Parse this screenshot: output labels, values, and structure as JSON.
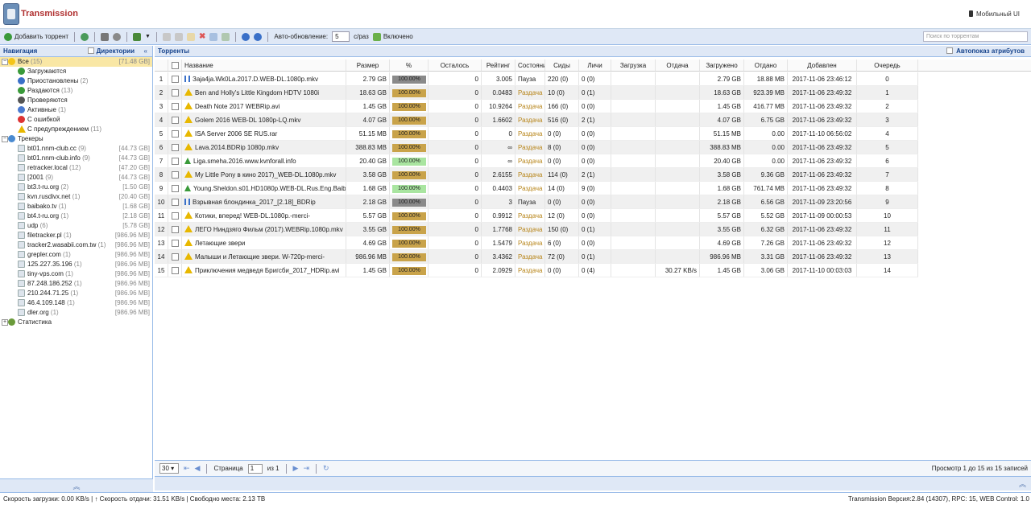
{
  "header": {
    "title": "Transmission",
    "mobile": "Мобильный UI"
  },
  "toolbar": {
    "add": "Добавить торрент",
    "auto_label": "Авто-обновление:",
    "auto_value": "5",
    "per": "с/раз",
    "enabled": "Включено",
    "search_placeholder": "Поиск по торрентам"
  },
  "nav": {
    "title": "Навигация",
    "dirs": "Директории",
    "items": [
      {
        "label": "Все",
        "count": "(15)",
        "size": "[71.48 GB]"
      },
      {
        "label": "Загружаются",
        "count": "",
        "size": ""
      },
      {
        "label": "Приостановлены",
        "count": "(2)",
        "size": ""
      },
      {
        "label": "Раздаются",
        "count": "(13)",
        "size": ""
      },
      {
        "label": "Проверяются",
        "count": "",
        "size": ""
      },
      {
        "label": "Активные",
        "count": "(1)",
        "size": ""
      },
      {
        "label": "С ошибкой",
        "count": "",
        "size": ""
      },
      {
        "label": "С предупреждением",
        "count": "(11)",
        "size": ""
      },
      {
        "label": "Трекеры",
        "count": "",
        "size": ""
      },
      {
        "label": "bt01.nnm-club.cc",
        "count": "(9)",
        "size": "[44.73 GB]"
      },
      {
        "label": "bt01.nnm-club.info",
        "count": "(9)",
        "size": "[44.73 GB]"
      },
      {
        "label": "retracker.local",
        "count": "(12)",
        "size": "[47.20 GB]"
      },
      {
        "label": "[2001",
        "count": "(9)",
        "size": "[44.73 GB]"
      },
      {
        "label": "bt3.t-ru.org",
        "count": "(2)",
        "size": "[1.50 GB]"
      },
      {
        "label": "kvn.rusdivx.net",
        "count": "(1)",
        "size": "[20.40 GB]"
      },
      {
        "label": "baibako.tv",
        "count": "(1)",
        "size": "[1.68 GB]"
      },
      {
        "label": "bt4.t-ru.org",
        "count": "(1)",
        "size": "[2.18 GB]"
      },
      {
        "label": "udp",
        "count": "(6)",
        "size": "[5.78 GB]"
      },
      {
        "label": "filetracker.pl",
        "count": "(1)",
        "size": "[986.96 MB]"
      },
      {
        "label": "tracker2.wasabii.com.tw",
        "count": "(1)",
        "size": "[986.96 MB]"
      },
      {
        "label": "grepler.com",
        "count": "(1)",
        "size": "[986.96 MB]"
      },
      {
        "label": "125.227.35.196",
        "count": "(1)",
        "size": "[986.96 MB]"
      },
      {
        "label": "tiny-vps.com",
        "count": "(1)",
        "size": "[986.96 MB]"
      },
      {
        "label": "87.248.186.252",
        "count": "(1)",
        "size": "[986.96 MB]"
      },
      {
        "label": "210.244.71.25",
        "count": "(1)",
        "size": "[986.96 MB]"
      },
      {
        "label": "46.4.109.148",
        "count": "(1)",
        "size": "[986.96 MB]"
      },
      {
        "label": "dler.org",
        "count": "(1)",
        "size": "[986.96 MB]"
      },
      {
        "label": "Статистика",
        "count": "",
        "size": ""
      }
    ]
  },
  "torrents": {
    "title": "Торренты",
    "autoshow": "Автопоказ атрибутов",
    "columns": [
      "Название",
      "Размер",
      "%",
      "Осталось",
      "Рейтинг",
      "Состояние",
      "Сиды",
      "Личи",
      "Загрузка",
      "Отдача",
      "Загружено",
      "Отдано",
      "Добавлен",
      "Очередь"
    ],
    "rows": [
      {
        "n": "1",
        "name": "Зajа4ja.Wk0La.2017.D.WEB-DL.1080p.mkv",
        "size": "2.79 GB",
        "pct": "100.00%",
        "left": "0",
        "ratio": "3.005",
        "state": "Пауза",
        "seeds": "220 (0)",
        "leech": "0 (0)",
        "down": "",
        "up": "",
        "dl": "2.79 GB",
        "ul": "18.88 MB",
        "added": "2017-11-06 23:46:12",
        "queue": "0",
        "icon": "pause",
        "bar": "gray"
      },
      {
        "n": "2",
        "name": "Ben and Holly's Little Kingdom HDTV 1080i",
        "size": "18.63 GB",
        "pct": "100.00%",
        "left": "0",
        "ratio": "0.0483",
        "state": "Раздача",
        "seeds": "10 (0)",
        "leech": "0 (1)",
        "down": "",
        "up": "",
        "dl": "18.63 GB",
        "ul": "923.39 MB",
        "added": "2017-11-06 23:49:32",
        "queue": "1",
        "icon": "warn",
        "bar": "gold"
      },
      {
        "n": "3",
        "name": "Death Note 2017 WEBRip.avi",
        "size": "1.45 GB",
        "pct": "100.00%",
        "left": "0",
        "ratio": "10.9264",
        "state": "Раздача",
        "seeds": "166 (0)",
        "leech": "0 (0)",
        "down": "",
        "up": "",
        "dl": "1.45 GB",
        "ul": "416.77 MB",
        "added": "2017-11-06 23:49:32",
        "queue": "2",
        "icon": "warn",
        "bar": "gold"
      },
      {
        "n": "4",
        "name": "Golem 2016 WEB-DL 1080p-LQ.mkv",
        "size": "4.07 GB",
        "pct": "100.00%",
        "left": "0",
        "ratio": "1.6602",
        "state": "Раздача",
        "seeds": "516 (0)",
        "leech": "2 (1)",
        "down": "",
        "up": "",
        "dl": "4.07 GB",
        "ul": "6.75 GB",
        "added": "2017-11-06 23:49:32",
        "queue": "3",
        "icon": "warn",
        "bar": "gold"
      },
      {
        "n": "5",
        "name": "ISA Server 2006 SE RUS.rar",
        "size": "51.15 MB",
        "pct": "100.00%",
        "left": "0",
        "ratio": "0",
        "state": "Раздача",
        "seeds": "0 (0)",
        "leech": "0 (0)",
        "down": "",
        "up": "",
        "dl": "51.15 MB",
        "ul": "0.00",
        "added": "2017-11-10 06:56:02",
        "queue": "4",
        "icon": "warn",
        "bar": "gold"
      },
      {
        "n": "6",
        "name": "Lava.2014.BDRip 1080p.mkv",
        "size": "388.83 MB",
        "pct": "100.00%",
        "left": "0",
        "ratio": "∞",
        "state": "Раздача",
        "seeds": "8 (0)",
        "leech": "0 (0)",
        "down": "",
        "up": "",
        "dl": "388.83 MB",
        "ul": "0.00",
        "added": "2017-11-06 23:49:32",
        "queue": "5",
        "icon": "warn",
        "bar": "gold"
      },
      {
        "n": "7",
        "name": "Liga.smeha.2016.www.kvnforall.info",
        "size": "20.40 GB",
        "pct": "100.00%",
        "left": "0",
        "ratio": "∞",
        "state": "Раздача",
        "seeds": "0 (0)",
        "leech": "0 (0)",
        "down": "",
        "up": "",
        "dl": "20.40 GB",
        "ul": "0.00",
        "added": "2017-11-06 23:49:32",
        "queue": "6",
        "icon": "up",
        "bar": "green"
      },
      {
        "n": "8",
        "name": "My Little Pony в кино 2017)_WEB-DL.1080p.mkv",
        "size": "3.58 GB",
        "pct": "100.00%",
        "left": "0",
        "ratio": "2.6155",
        "state": "Раздача",
        "seeds": "114 (0)",
        "leech": "2 (1)",
        "down": "",
        "up": "",
        "dl": "3.58 GB",
        "ul": "9.36 GB",
        "added": "2017-11-06 23:49:32",
        "queue": "7",
        "icon": "warn",
        "bar": "gold"
      },
      {
        "n": "9",
        "name": "Young.Sheldon.s01.HD1080p.WEB-DL.Rus.Eng.BaibaKo.tv",
        "size": "1.68 GB",
        "pct": "100.00%",
        "left": "0",
        "ratio": "0.4403",
        "state": "Раздача",
        "seeds": "14 (0)",
        "leech": "9 (0)",
        "down": "",
        "up": "",
        "dl": "1.68 GB",
        "ul": "761.74 MB",
        "added": "2017-11-06 23:49:32",
        "queue": "8",
        "icon": "up",
        "bar": "green"
      },
      {
        "n": "10",
        "name": "Взрывная блондинка_2017_[2.18]_BDRip",
        "size": "2.18 GB",
        "pct": "100.00%",
        "left": "0",
        "ratio": "3",
        "state": "Пауза",
        "seeds": "0 (0)",
        "leech": "0 (0)",
        "down": "",
        "up": "",
        "dl": "2.18 GB",
        "ul": "6.56 GB",
        "added": "2017-11-09 23:20:56",
        "queue": "9",
        "icon": "pause",
        "bar": "gray"
      },
      {
        "n": "11",
        "name": "Котики, вперед! WEB-DL.1080p.-merci-",
        "size": "5.57 GB",
        "pct": "100.00%",
        "left": "0",
        "ratio": "0.9912",
        "state": "Раздача",
        "seeds": "12 (0)",
        "leech": "0 (0)",
        "down": "",
        "up": "",
        "dl": "5.57 GB",
        "ul": "5.52 GB",
        "added": "2017-11-09 00:00:53",
        "queue": "10",
        "icon": "warn",
        "bar": "gold"
      },
      {
        "n": "12",
        "name": "ЛЕГО Ниндзяго Фильм (2017).WEBRip.1080p.mkv",
        "size": "3.55 GB",
        "pct": "100.00%",
        "left": "0",
        "ratio": "1.7768",
        "state": "Раздача",
        "seeds": "150 (0)",
        "leech": "0 (1)",
        "down": "",
        "up": "",
        "dl": "3.55 GB",
        "ul": "6.32 GB",
        "added": "2017-11-06 23:49:32",
        "queue": "11",
        "icon": "warn",
        "bar": "gold"
      },
      {
        "n": "13",
        "name": "Летающие звери",
        "size": "4.69 GB",
        "pct": "100.00%",
        "left": "0",
        "ratio": "1.5479",
        "state": "Раздача",
        "seeds": "6 (0)",
        "leech": "0 (0)",
        "down": "",
        "up": "",
        "dl": "4.69 GB",
        "ul": "7.26 GB",
        "added": "2017-11-06 23:49:32",
        "queue": "12",
        "icon": "warn",
        "bar": "gold"
      },
      {
        "n": "14",
        "name": "Малыши и Летающие звери. W-720p-merci-",
        "size": "986.96 MB",
        "pct": "100.00%",
        "left": "0",
        "ratio": "3.4362",
        "state": "Раздача",
        "seeds": "72 (0)",
        "leech": "0 (1)",
        "down": "",
        "up": "",
        "dl": "986.96 MB",
        "ul": "3.31 GB",
        "added": "2017-11-06 23:49:32",
        "queue": "13",
        "icon": "warn",
        "bar": "gold"
      },
      {
        "n": "15",
        "name": "Приключения медведя Бригсби_2017_HDRip.avi",
        "size": "1.45 GB",
        "pct": "100.00%",
        "left": "0",
        "ratio": "2.0929",
        "state": "Раздача",
        "seeds": "0 (0)",
        "leech": "0 (4)",
        "down": "",
        "up": "30.27 KB/s",
        "dl": "1.45 GB",
        "ul": "3.06 GB",
        "added": "2017-11-10 00:03:03",
        "queue": "14",
        "icon": "warn",
        "bar": "gold"
      }
    ]
  },
  "pager": {
    "per_page": "30",
    "page_label": "Страница",
    "page": "1",
    "of": "из 1",
    "info": "Просмотр 1 до 15 из 15 записей"
  },
  "status": {
    "left": "Скорость загрузки: 0.00 KB/s | ↑ Скорость отдачи: 31.51 KB/s | Свободно места: 2.13 TB",
    "right": "Transmission Версия:2.84 (14307), RPC: 15, WEB Control: 1.0"
  },
  "colors": {
    "accent": "#15428b",
    "panel": "#dfe8f6",
    "progress_gold": "#c9a34a",
    "progress_gray": "#8a8a8a",
    "progress_green": "#a9e5a0",
    "seeding": "#b8861b"
  }
}
